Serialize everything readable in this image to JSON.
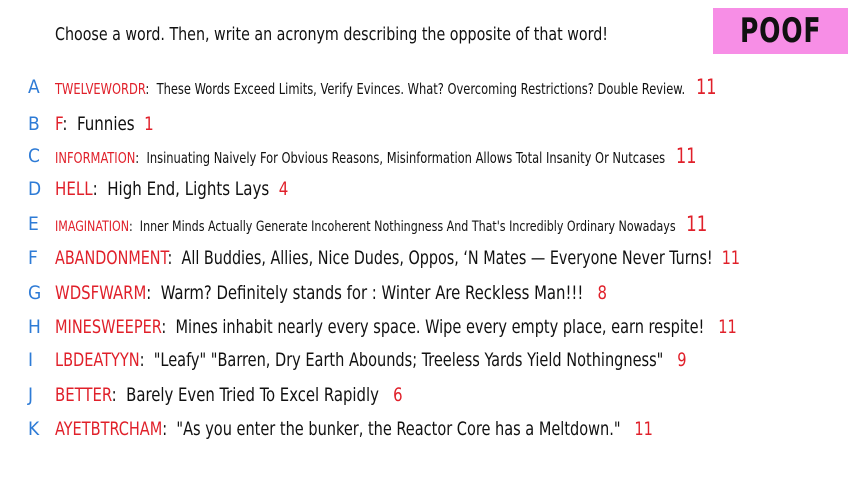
{
  "header": {
    "prompt": "Choose a word. Then, write an acronym describing the opposite of that word!",
    "badge": "POOF"
  },
  "entries": [
    {
      "letter": "A",
      "word": "TWELVEWORDR",
      "acronym": "These Words Exceed Limits, Verify Evinces. What? Overcoming Restrictions? Double Review.",
      "score": "11"
    },
    {
      "letter": "B",
      "word": "F",
      "acronym": "Funnies",
      "score": "1"
    },
    {
      "letter": "C",
      "word": "INFORMATION",
      "acronym": "Insinuating Naively For Obvious Reasons, Misinformation Allows Total Insanity Or Nutcases",
      "score": "11"
    },
    {
      "letter": "D",
      "word": "HELL",
      "acronym": "High End, Lights Lays",
      "score": "4"
    },
    {
      "letter": "E",
      "word": "IMAGINATION",
      "acronym": "Inner Minds Actually Generate Incoherent Nothingness And That's Incredibly Ordinary Nowadays",
      "score": "11"
    },
    {
      "letter": "F",
      "word": "ABANDONMENT",
      "acronym": "All Buddies, Allies, Nice Dudes, Oppos, ‘N Mates — Everyone Never Turns!",
      "score": "11"
    },
    {
      "letter": "G",
      "word": "WDSFWARM",
      "acronym": "Warm? Definitely stands for : Winter Are Reckless Man!!!",
      "score": "8"
    },
    {
      "letter": "H",
      "word": "MINESWEEPER",
      "acronym": "Mines inhabit nearly every space. Wipe every empty place, earn respite!",
      "score": "11"
    },
    {
      "letter": "I",
      "word": "LBDEATYYN",
      "acronym": "\"Leafy\" \"Barren, Dry Earth Abounds; Treeless Yards Yield Nothingness\"",
      "score": "9"
    },
    {
      "letter": "J",
      "word": "BETTER",
      "acronym": "Barely Even Tried To Excel Rapidly",
      "score": "6"
    },
    {
      "letter": "K",
      "word": "AYETBTRCHAM",
      "acronym": "\"As you enter the bunker, the Reactor Core has a Meltdown.\"",
      "score": "11"
    }
  ]
}
